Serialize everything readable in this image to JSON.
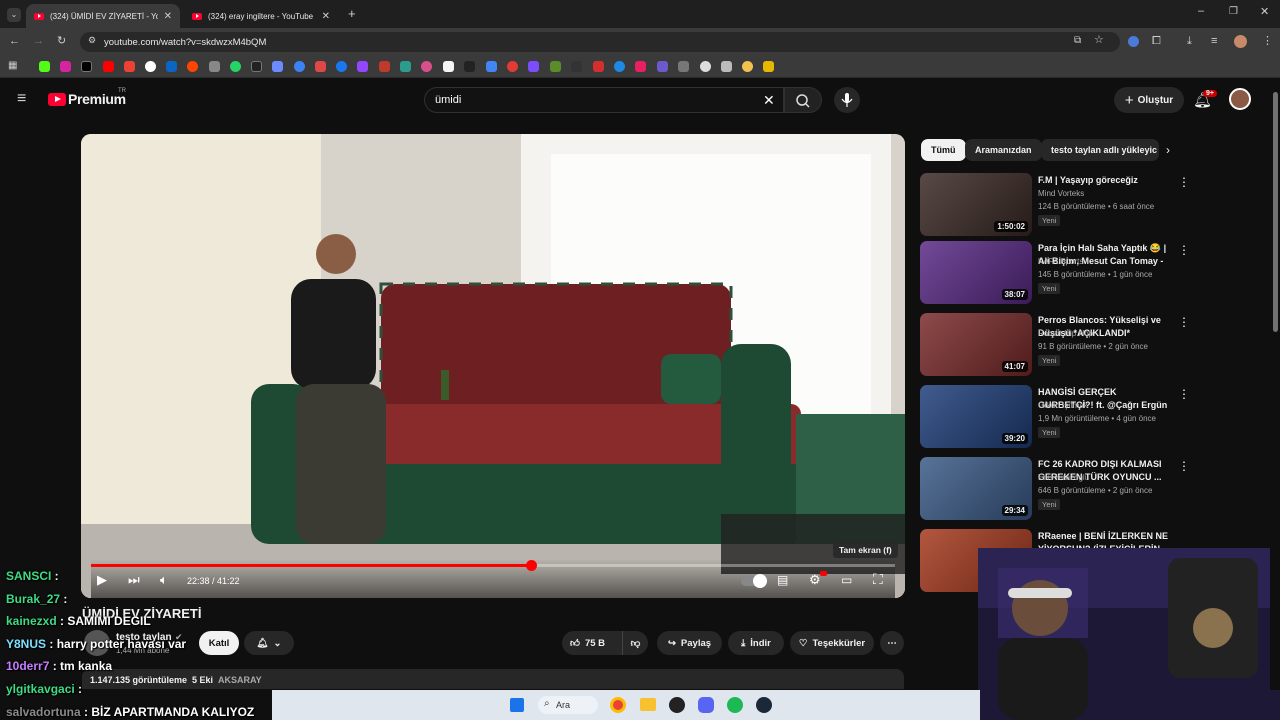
{
  "browser": {
    "tabs": [
      {
        "title": "(324) ÜMİDİ EV ZİYARETİ - YouTube",
        "active": true
      },
      {
        "title": "(324) eray ingiltere - YouTube",
        "active": false
      }
    ],
    "url": "youtube.com/watch?v=skdwzxM4bQM"
  },
  "youtube": {
    "logo_text": "Premium",
    "logo_badge": "TR",
    "search_value": "ümidi",
    "create_label": "Oluştur",
    "notif_count": "9+"
  },
  "player": {
    "time_text": "22:38 / 41:22",
    "progress_fraction": 0.547,
    "fullscreen_tooltip": "Tam ekran (f)"
  },
  "video": {
    "title": "ÜMİDİ EV ZİYARETİ",
    "channel": "testo taylan",
    "subscribers": "1,44 Mn abone",
    "join_label": "Katıl",
    "likes": "75 B",
    "share_label": "Paylaş",
    "download_label": "İndir",
    "thanks_label": "Teşekkürler",
    "views_line": "1.147.135 görüntüleme",
    "date": "5 Eki",
    "location": "AKSARAY"
  },
  "chips": [
    "Tümü",
    "Aramanızdan",
    "testo taylan adlı yükleyic"
  ],
  "recommendations": [
    {
      "title": "F.M | Yaşayıp göreceğiz",
      "channel": "Mind Vorteks",
      "meta": "124 B görüntüleme • 6 saat önce",
      "badge": "Yeni",
      "duration": "1:50:02",
      "color": "#3b2a26"
    },
    {
      "title": "Para İçin Halı Saha Yaptık 😂 | Ali Biçim, Mesut Can Tomay - ...",
      "channel": "KAFA Sports",
      "meta": "145 B görüntüleme • 1 gün önce",
      "badge": "Yeni",
      "duration": "38:07",
      "color": "#5a2a86"
    },
    {
      "title": "Perros Blancos: Yükselişi ve Düşüşü *AÇIKLANDI*",
      "channel": "Robert Hip Hop",
      "meta": "91 B görüntüleme • 2 gün önce",
      "badge": "Yeni",
      "duration": "41:07",
      "color": "#7a2b2b"
    },
    {
      "title": "HANGİSİ GERÇEK GURBETÇİ?! ft. @Çağrı Ergün",
      "channel": "Orkun Işıtmak",
      "meta": "1,9 Mn görüntüleme • 4 gün önce",
      "badge": "Yeni",
      "duration": "39:20",
      "color": "#1f3f7a"
    },
    {
      "title": "FC 26 KADRO DIŞI KALMASI GEREKEN TÜRK OYUNCU ...",
      "channel": "Enis Kirazoglu",
      "meta": "646 B görüntüleme • 2 gün önce",
      "badge": "Yeni",
      "duration": "29:34",
      "color": "#3b5b88"
    },
    {
      "title": "RRaenee | BENİ İZLERKEN NE YİYORSUN? (İZLEYİCİLERİN",
      "channel": "",
      "meta": "",
      "badge": "",
      "duration": "",
      "color": "#a63a1e"
    }
  ],
  "chat": [
    {
      "user": "SANSCI",
      "msg": "",
      "color": "#3ddc84"
    },
    {
      "user": "Burak_27",
      "msg": "",
      "color": "#3ddc84"
    },
    {
      "user": "kainezxd",
      "msg": "SAMIMI DEGIL",
      "color": "#3ddc84"
    },
    {
      "user": "Y8NUS",
      "msg": "harry potter havası var",
      "color": "#7ee0ff"
    },
    {
      "user": "10derr7",
      "msg": "tm kanka",
      "color": "#c77dff"
    },
    {
      "user": "ylgitkavgaci",
      "msg": "",
      "color": "#3ddc84"
    },
    {
      "user": "salvadortuna",
      "msg": "BİZ APARTMANDA KALIYOZ",
      "color": "#8a8a8a"
    }
  ],
  "taskbar": {
    "search_label": "Ara"
  }
}
